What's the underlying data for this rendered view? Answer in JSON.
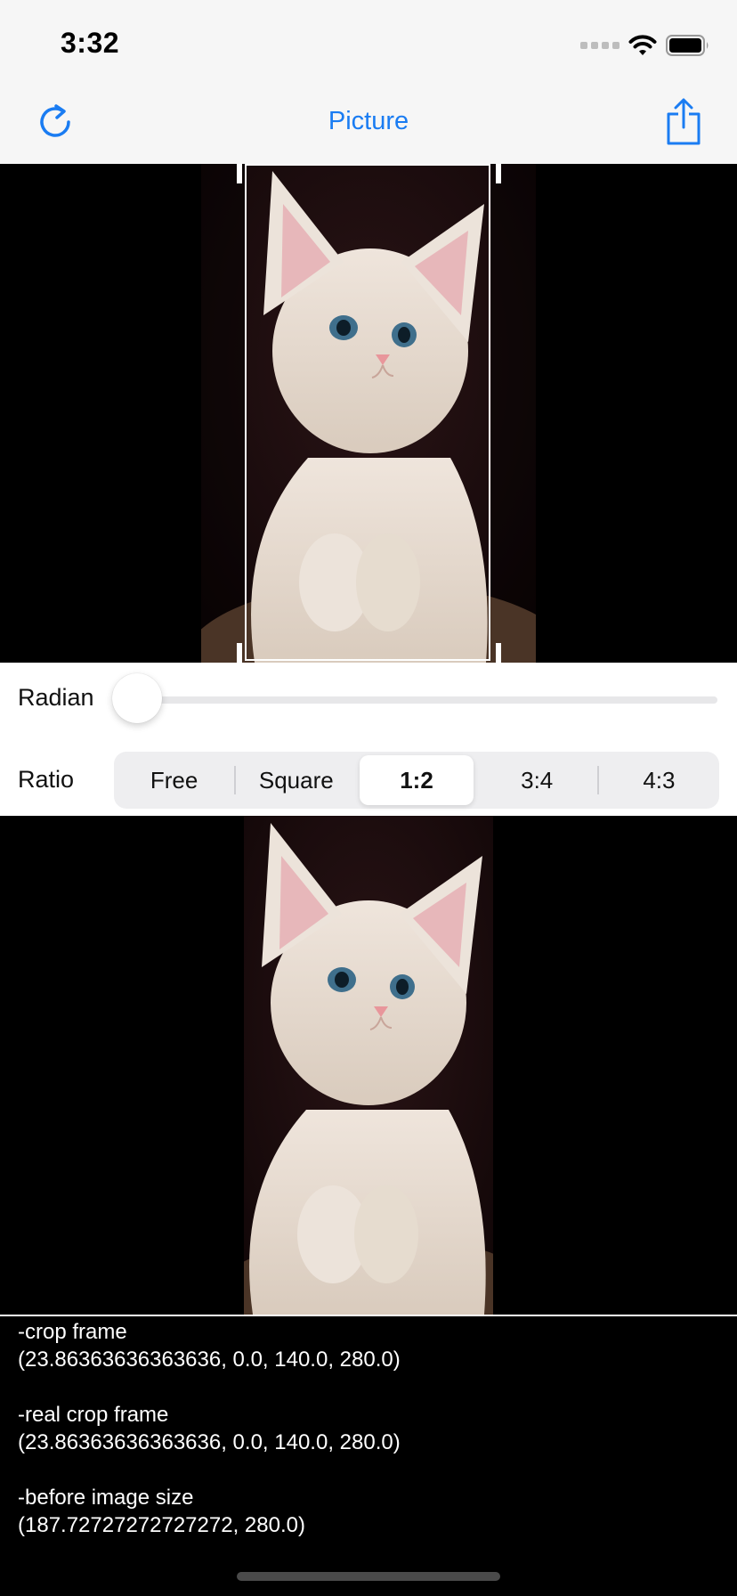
{
  "status_bar": {
    "time": "3:32",
    "icons": [
      "cellular-signal-icon",
      "wifi-icon",
      "battery-icon"
    ]
  },
  "nav": {
    "title": "Picture",
    "left_icon": "refresh-icon",
    "right_icon": "share-icon"
  },
  "controls": {
    "radian_label": "Radian",
    "radian_value": 0.0,
    "ratio_label": "Ratio",
    "ratio_options": [
      "Free",
      "Square",
      "1:2",
      "3:4",
      "4:3"
    ],
    "ratio_selected": "1:2"
  },
  "info": {
    "crop_frame_label": "-crop frame",
    "crop_frame_value": "(23.86363636363636, 0.0, 140.0, 280.0)",
    "real_crop_frame_label": "-real crop frame",
    "real_crop_frame_value": "(23.86363636363636, 0.0, 140.0, 280.0)",
    "before_image_size_label": "-before image size",
    "before_image_size_value": "(187.72727272727272, 280.0)"
  },
  "colors": {
    "accent": "#1a7cf2",
    "bar_background": "#f6f6f6"
  }
}
